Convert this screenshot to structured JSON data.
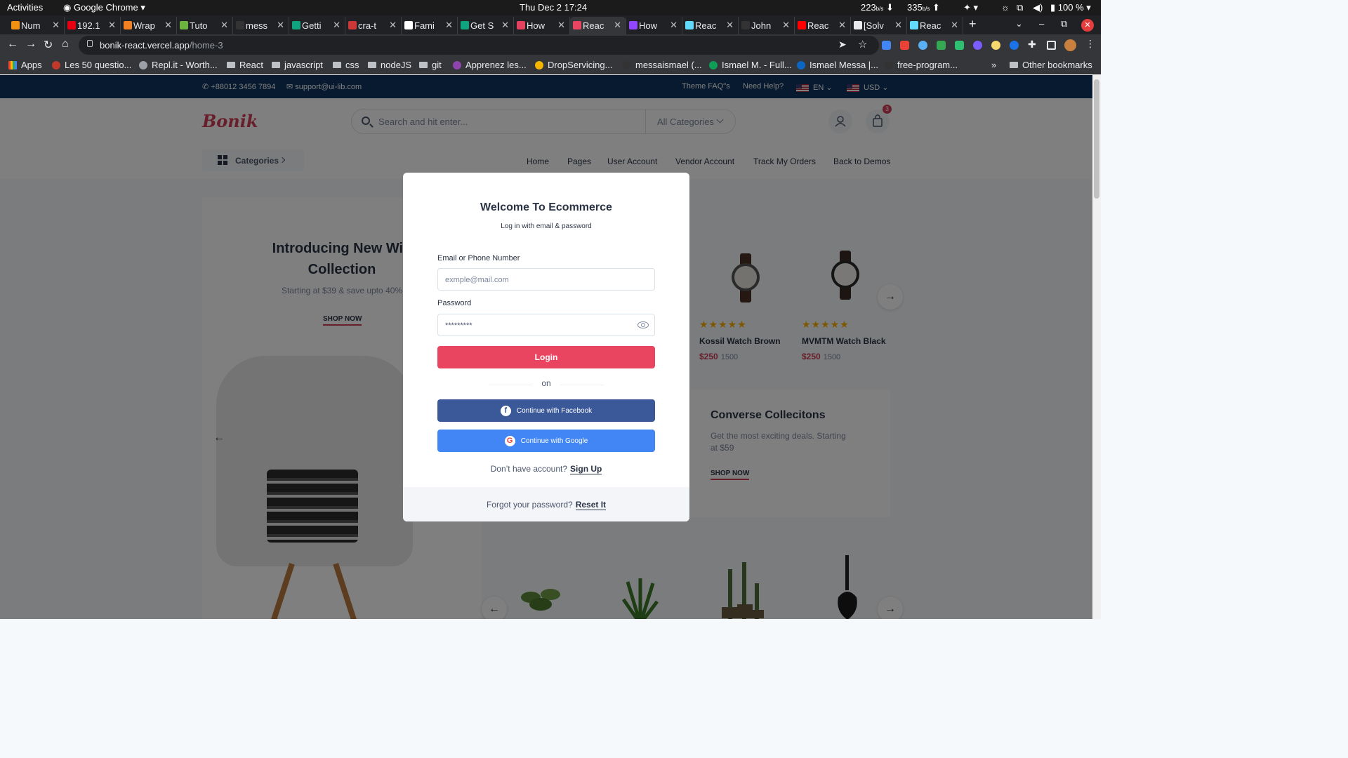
{
  "os": {
    "activities": "Activities",
    "app": "Google Chrome",
    "clock": "Thu Dec 2  17:24",
    "net_down": "223",
    "net_down_unit": "b/s",
    "net_up": "335",
    "net_up_unit": "b/s",
    "battery": "100 %"
  },
  "browser": {
    "tabs": [
      {
        "title": "Num",
        "color": "#f29111"
      },
      {
        "title": "192.1",
        "color": "#e60012"
      },
      {
        "title": "Wrap",
        "color": "#f48024"
      },
      {
        "title": "Tuto",
        "color": "#6db33f"
      },
      {
        "title": "mess",
        "color": "#333333"
      },
      {
        "title": "Getti",
        "color": "#10a37f"
      },
      {
        "title": "cra-t",
        "color": "#cb3837"
      },
      {
        "title": "Fami",
        "color": "#ffffff"
      },
      {
        "title": "Get S",
        "color": "#10a37f"
      },
      {
        "title": "How",
        "color": "#e4405f"
      },
      {
        "title": "Reac",
        "color": "#e94560"
      },
      {
        "title": "How",
        "color": "#9146ff"
      },
      {
        "title": "Reac",
        "color": "#61dafb"
      },
      {
        "title": "John",
        "color": "#333333"
      },
      {
        "title": "Reac",
        "color": "#ff0000"
      },
      {
        "title": "[Solv",
        "color": "#e8eaed"
      },
      {
        "title": "Reac",
        "color": "#61dafb"
      }
    ],
    "url_host": "bonik-react.vercel.app",
    "url_path": "/home-3",
    "bookmarks": [
      {
        "label": "Apps",
        "kind": "apps"
      },
      {
        "label": "Les 50 questio...",
        "kind": "site"
      },
      {
        "label": "Repl.it - Worth...",
        "kind": "site"
      },
      {
        "label": "React",
        "kind": "folder"
      },
      {
        "label": "javascript",
        "kind": "folder"
      },
      {
        "label": "css",
        "kind": "folder"
      },
      {
        "label": "nodeJS",
        "kind": "folder"
      },
      {
        "label": "git",
        "kind": "folder"
      },
      {
        "label": "Apprenez les...",
        "kind": "site"
      },
      {
        "label": "DropServicing...",
        "kind": "site"
      },
      {
        "label": "messaismael (...",
        "kind": "site"
      },
      {
        "label": "Ismael M. - Full...",
        "kind": "site"
      },
      {
        "label": "Ismael Messa |...",
        "kind": "site"
      },
      {
        "label": "free-program...",
        "kind": "site"
      }
    ],
    "more_bookmarks": "»",
    "other_bookmarks": "Other bookmarks"
  },
  "site": {
    "topbar": {
      "phone": "+88012 3456 7894",
      "email": "support@ui-lib.com",
      "faq": "Theme FAQ\"s",
      "help": "Need Help?",
      "lang": "EN",
      "currency": "USD"
    },
    "logo": "Bonik",
    "search_placeholder": "Search and hit enter...",
    "search_category": "All Categories",
    "cart_count": "3",
    "categories_label": "Categories",
    "nav": [
      "Home",
      "Pages",
      "User Account",
      "Vendor Account",
      "Track My Orders",
      "Back to Demos"
    ],
    "hero": {
      "title_line1": "Introducing New Win",
      "title_line2": "Collection",
      "subtitle": "Starting at $39 & save upto 40%",
      "cta": "SHOP NOW"
    },
    "products": [
      {
        "name": "Kossil Watch Brown",
        "price": "$250",
        "old_price": "1500",
        "rating": 5
      },
      {
        "name": "MVMTM Watch Black",
        "price": "$250",
        "old_price": "1500",
        "rating": 5
      }
    ],
    "promo": {
      "title": "Converse Collecitons",
      "text": "Get the most exciting deals. Starting at $59",
      "cta": "SHOP NOW"
    }
  },
  "modal": {
    "title": "Welcome To Ecommerce",
    "subtitle": "Log in with email & password",
    "email_label": "Email or Phone Number",
    "email_placeholder": "exmple@mail.com",
    "password_label": "Password",
    "password_value": "*********",
    "login_button": "Login",
    "divider_text": "on",
    "facebook_button": "Continue with Facebook",
    "google_button": "Continue with Google",
    "signup_prompt": "Don’t have account?",
    "signup_link": "Sign Up",
    "forgot_prompt": "Forgot your password?",
    "reset_link": "Reset It"
  }
}
